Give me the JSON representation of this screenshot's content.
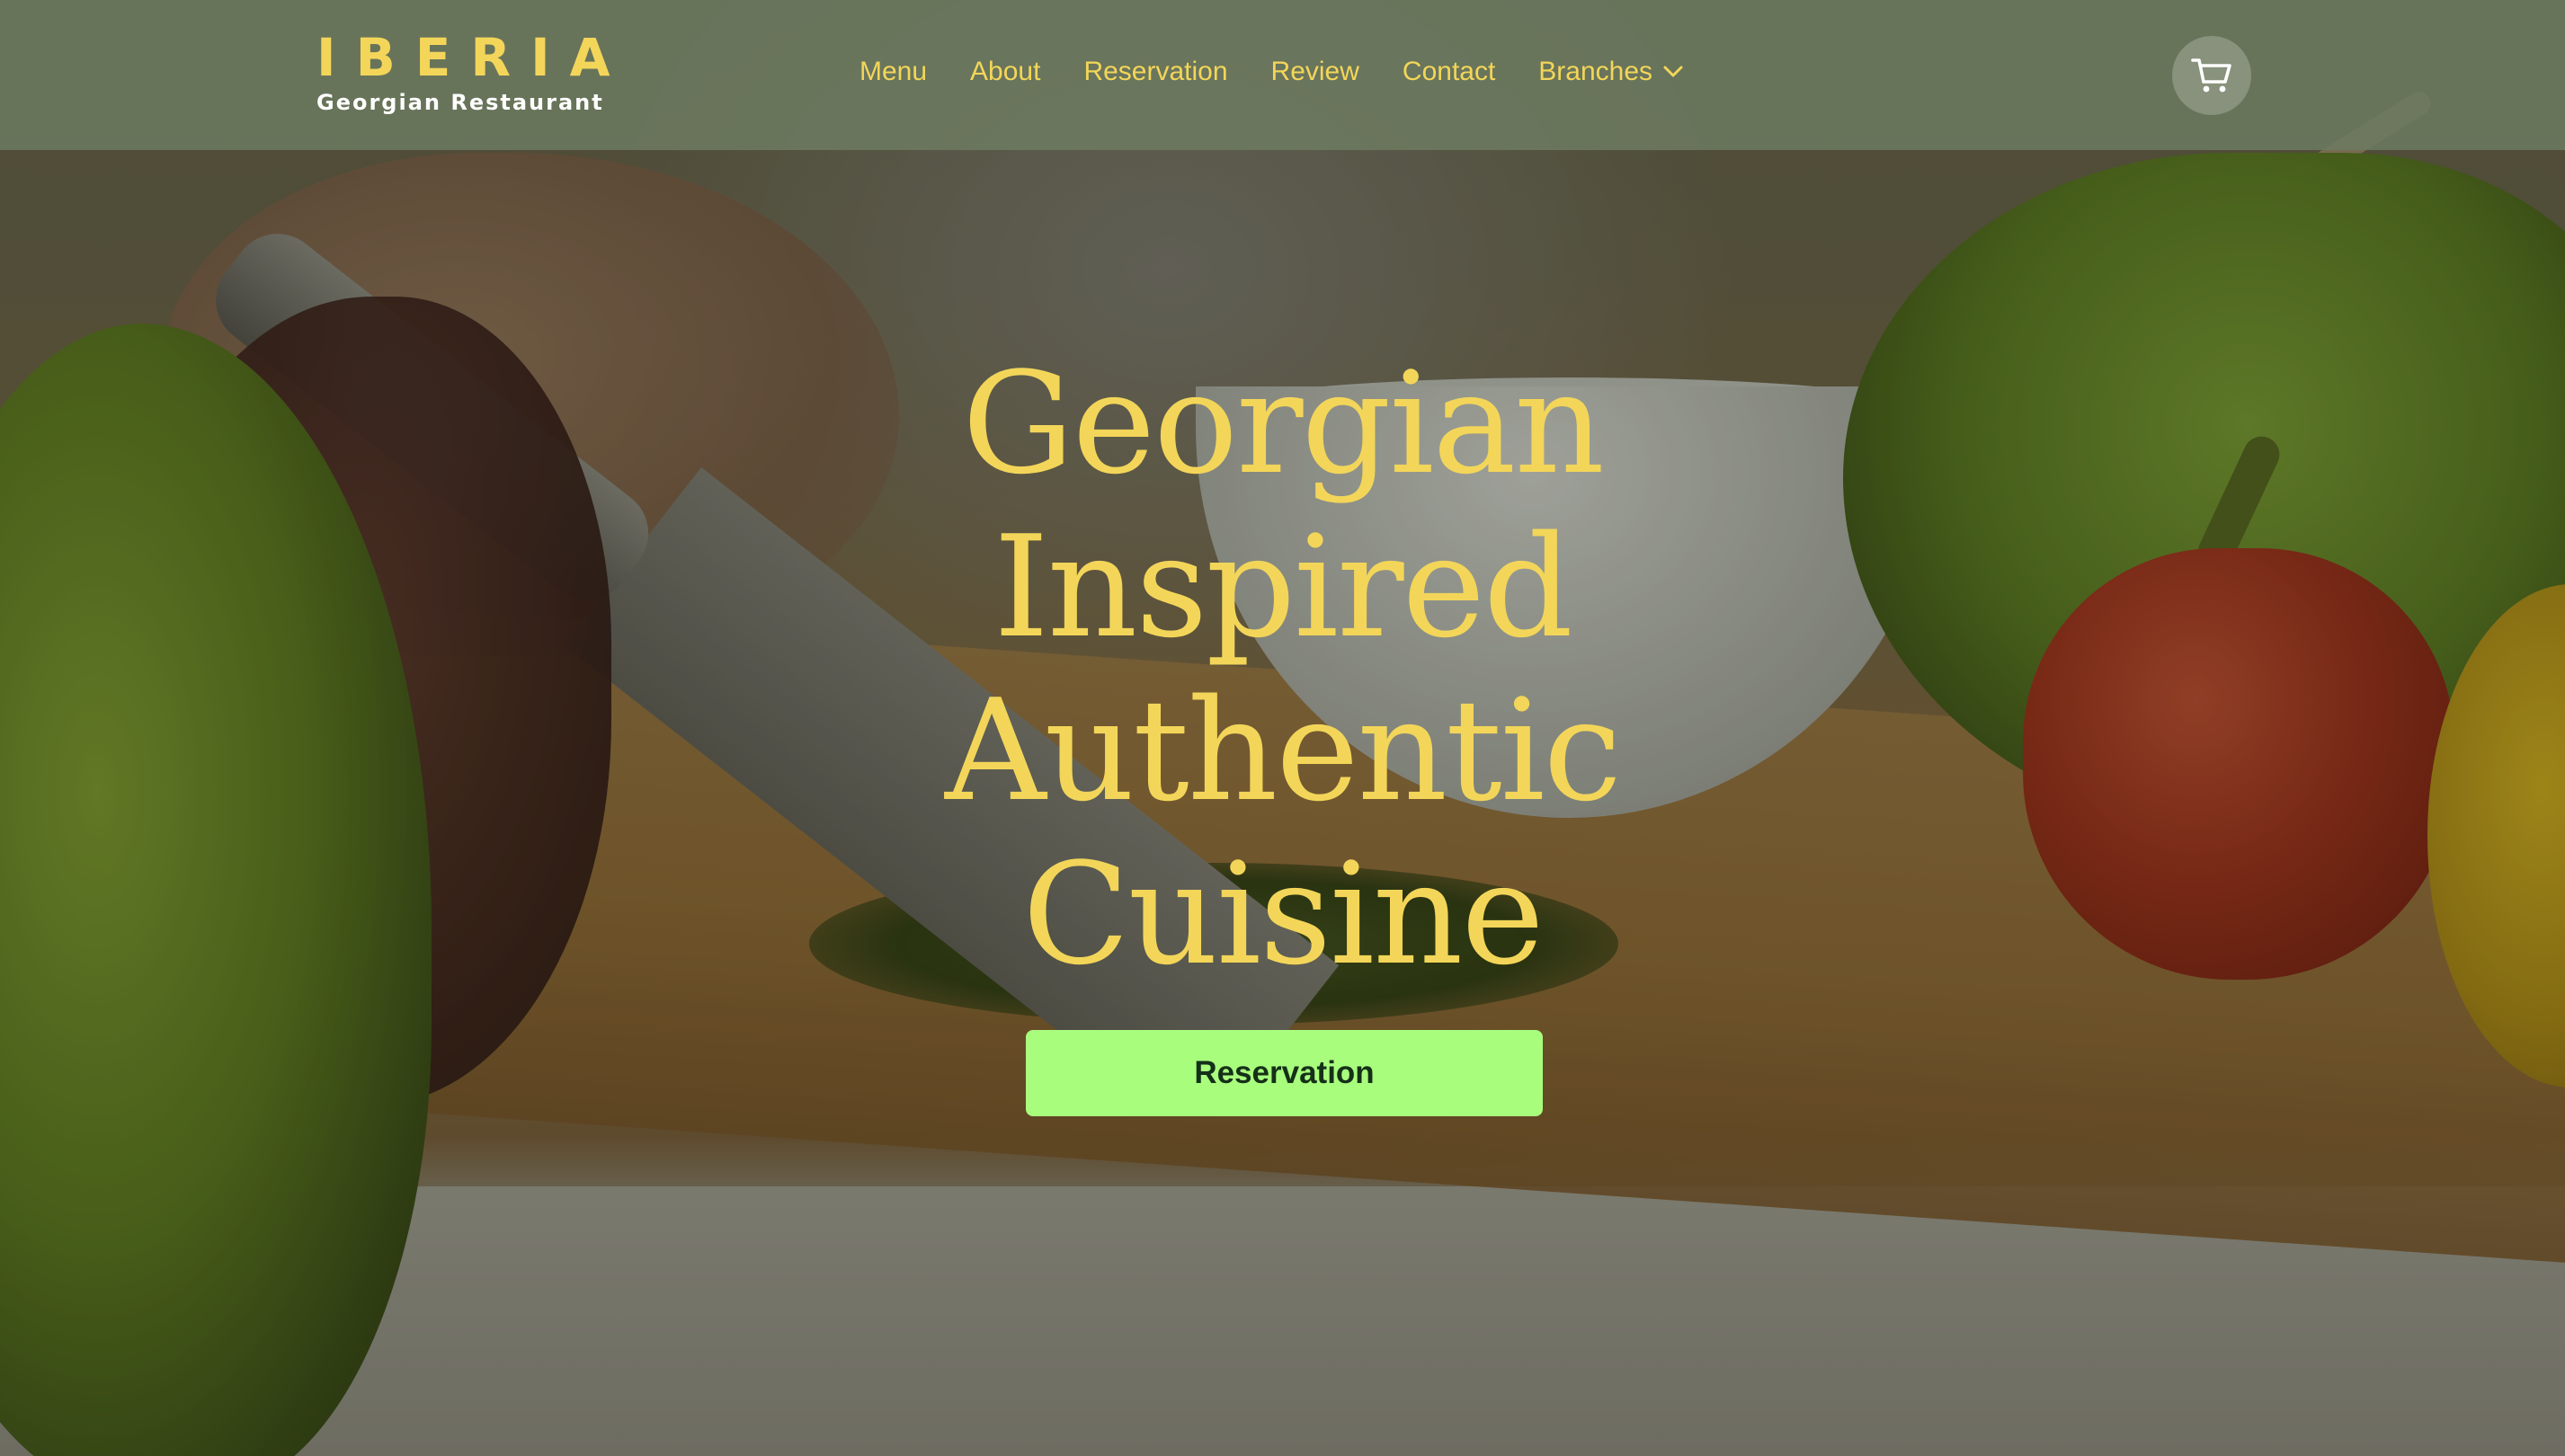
{
  "brand": {
    "title": "IBERIA",
    "subtitle": "Georgian Restaurant",
    "accent_color": "#f3d659"
  },
  "nav": {
    "items": [
      {
        "label": "Menu"
      },
      {
        "label": "About"
      },
      {
        "label": "Reservation"
      },
      {
        "label": "Review"
      },
      {
        "label": "Contact"
      },
      {
        "label": "Branches",
        "icon": "chevron-down-icon"
      }
    ]
  },
  "cart": {
    "icon": "cart-icon"
  },
  "hero": {
    "heading_lines": [
      "Georgian",
      "Inspired",
      "Authentic",
      "Cuisine"
    ],
    "cta_label": "Reservation",
    "cta_color": "#a9fd7d"
  }
}
